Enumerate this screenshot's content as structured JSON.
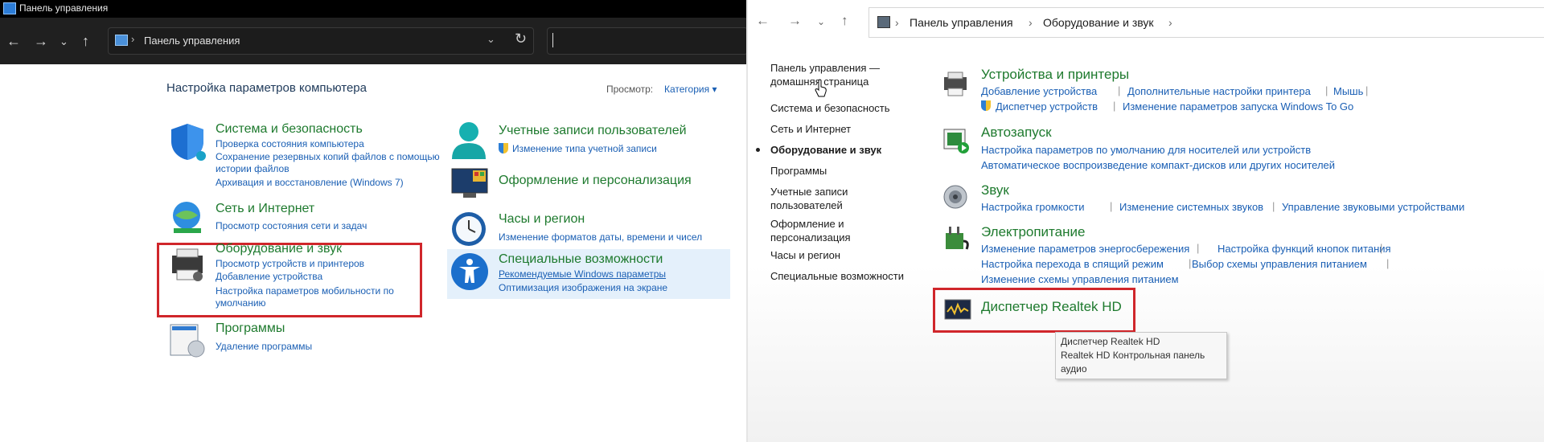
{
  "left": {
    "window_title": "Панель управления",
    "address": "Панель управления",
    "heading": "Настройка параметров компьютера",
    "view_label": "Просмотр:",
    "view_value": "Категория",
    "categories": [
      {
        "title": "Система и безопасность",
        "links": [
          "Проверка состояния компьютера",
          "Сохранение резервных копий файлов с помощью",
          "истории файлов",
          "Архивация и восстановление (Windows 7)"
        ]
      },
      {
        "title": "Сеть и Интернет",
        "links": [
          "Просмотр состояния сети и задач"
        ]
      },
      {
        "title": "Оборудование и звук",
        "links": [
          "Просмотр устройств и принтеров",
          "Добавление устройства",
          "Настройка параметров мобильности по",
          "умолчанию"
        ]
      },
      {
        "title": "Программы",
        "links": [
          "Удаление программы"
        ]
      },
      {
        "title": "Учетные записи пользователей",
        "links": [
          "Изменение типа учетной записи"
        ]
      },
      {
        "title": "Оформление и персонализация",
        "links": []
      },
      {
        "title": "Часы и регион",
        "links": [
          "Изменение форматов даты, времени и чисел"
        ]
      },
      {
        "title": "Специальные возможности",
        "links": [
          "Рекомендуемые Windows параметры",
          "Оптимизация изображения на экране"
        ]
      }
    ]
  },
  "right": {
    "breadcrumb": [
      "Панель управления",
      "Оборудование и звук"
    ],
    "sidebar": [
      "Панель управления —",
      "домашняя страница",
      "Система и безопасность",
      "Сеть и Интернет",
      "Оборудование и звук",
      "Программы",
      "Учетные записи",
      "пользователей",
      "Оформление и",
      "персонализация",
      "Часы и регион",
      "Специальные возможности"
    ],
    "sections": [
      {
        "title": "Устройства и принтеры",
        "rows": [
          [
            "Добавление устройства",
            "Дополнительные настройки принтера",
            "Мышь"
          ],
          [
            "Диспетчер устройств",
            "Изменение параметров запуска Windows To Go"
          ]
        ]
      },
      {
        "title": "Автозапуск",
        "rows": [
          [
            "Настройка параметров по умолчанию для носителей или устройств"
          ],
          [
            "Автоматическое воспроизведение компакт-дисков или других носителей"
          ]
        ]
      },
      {
        "title": "Звук",
        "rows": [
          [
            "Настройка громкости",
            "Изменение системных звуков",
            "Управление звуковыми устройствами"
          ]
        ]
      },
      {
        "title": "Электропитание",
        "rows": [
          [
            "Изменение параметров энергосбережения",
            "Настройка функций кнопок питания"
          ],
          [
            "Настройка перехода в спящий режим",
            "Выбор схемы управления питанием"
          ],
          [
            "Изменение схемы управления питанием"
          ]
        ]
      },
      {
        "title": "Диспетчер Realtek HD",
        "rows": []
      }
    ],
    "tooltip": [
      "Диспетчер Realtek HD",
      "Realtek HD Контрольная панель",
      "аудио"
    ]
  }
}
